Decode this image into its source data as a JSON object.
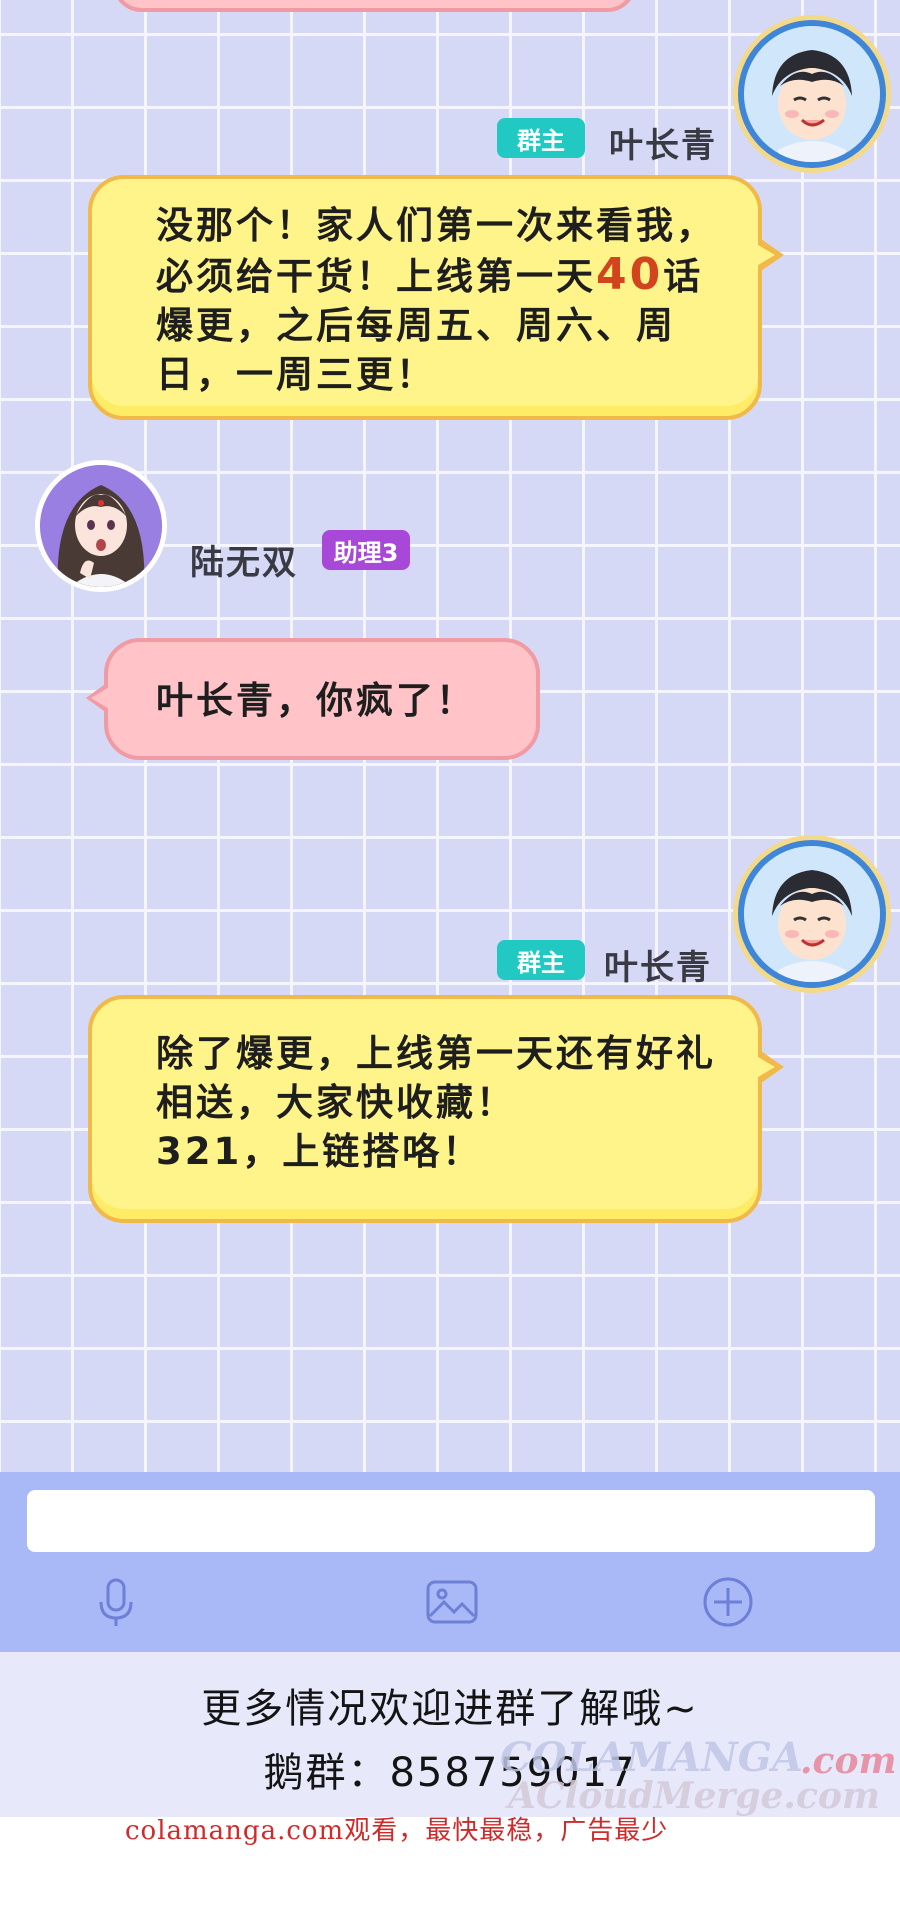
{
  "messages": [
    {
      "sender": "叶长青",
      "badge": "群主",
      "lines": [
        "没那个！家人们第一次来看我，",
        "必须给干货！上线第一天",
        "40",
        "话",
        "爆更，之后每周五、周六、周",
        "日，一周三更！"
      ]
    },
    {
      "sender": "陆无双",
      "badge": "助理3",
      "lines": [
        "叶长青，你疯了！"
      ]
    },
    {
      "sender": "叶长青",
      "badge": "群主",
      "lines": [
        "除了爆更，上线第一天还有好礼",
        "相送，大家快收藏！",
        "321，上链搭咯！"
      ]
    }
  ],
  "input_bar": {
    "placeholder": "",
    "icons": [
      "microphone-icon",
      "image-icon",
      "plus-icon"
    ]
  },
  "footer": {
    "line1": "更多情况欢迎进群了解哦~",
    "line2": "鹅群：858759017"
  },
  "watermark": {
    "text1": "COLAMANGA",
    "text2": ".com",
    "text3": "ACloudMerge.com"
  },
  "ad_text": "colamanga.com观看，最快最稳，广告最少",
  "colors": {
    "owner_badge": "#22c8c2",
    "assistant_badge": "#a848d8",
    "yellow_bubble": "#fff48a",
    "pink_bubble": "#ffc3c8",
    "highlight": "#d2441e"
  }
}
